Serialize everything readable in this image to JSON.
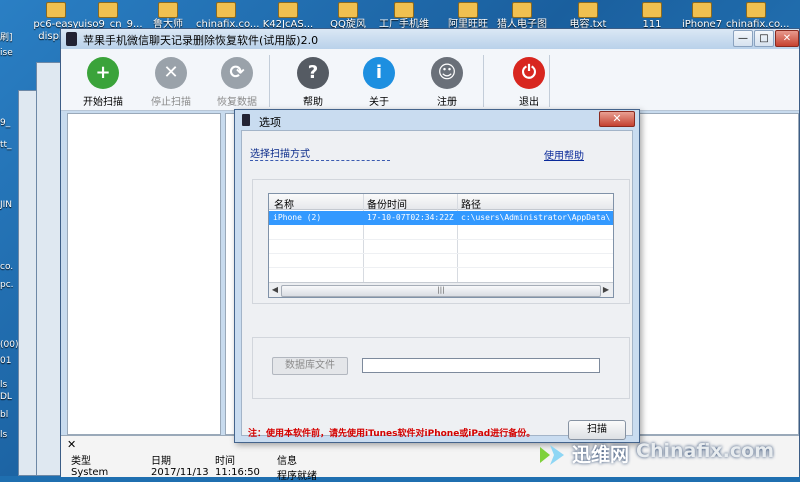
{
  "desktop": {
    "icons": [
      "pc6-easy display",
      "uiso9_cn_9...",
      "鲁大师",
      "chinafix.co...",
      "K42JcAS...",
      "QQ旋风",
      "工厂手机维",
      "阿里旺旺",
      "猎人电子图",
      "电容.txt",
      "111",
      "iPhone7",
      "chinafix.co..."
    ],
    "side_labels": [
      "刷]",
      "ise",
      "9_",
      "tt_",
      "JIN",
      "co.",
      "pc.",
      "(00)",
      "01",
      "ls",
      "DL",
      "bl",
      "ls"
    ]
  },
  "window": {
    "title": "苹果手机微信聊天记录删除恢复软件(试用版)2.0",
    "controls": {
      "minimize": "—",
      "maximize": "□",
      "close": "✕"
    }
  },
  "toolbar": [
    {
      "label": "开始扫描",
      "icon": "plus-icon",
      "color": "#3aa33a",
      "glyph": "+",
      "enabled": true
    },
    {
      "label": "停止扫描",
      "icon": "stop-icon",
      "color": "#9aa2aa",
      "glyph": "✕",
      "enabled": false
    },
    {
      "label": "恢复数据",
      "icon": "refresh-icon",
      "color": "#9aa2aa",
      "glyph": "⟳",
      "enabled": false
    },
    {
      "label": "帮助",
      "icon": "help-icon",
      "color": "#555b63",
      "glyph": "?",
      "enabled": true
    },
    {
      "label": "关于",
      "icon": "info-icon",
      "color": "#1d8fe0",
      "glyph": "i",
      "enabled": true
    },
    {
      "label": "注册",
      "icon": "user-icon",
      "color": "#6a7079",
      "glyph": "☺",
      "enabled": true
    },
    {
      "label": "退出",
      "icon": "power-icon",
      "color": "#d8261f",
      "glyph": "⏻",
      "enabled": true
    }
  ],
  "log": {
    "close": "✕",
    "columns": [
      "类型",
      "日期",
      "时间",
      "信息"
    ],
    "row": [
      "System",
      "2017/11/13",
      "11:16:50",
      "程序就绪"
    ]
  },
  "dialog": {
    "title": "选项",
    "close": "✕",
    "scan_method_label": "选择扫描方式",
    "help_link": "使用帮助",
    "table": {
      "columns": [
        "名称",
        "备份时间",
        "路径"
      ],
      "rows": [
        [
          "iPhone (2)",
          "17-10-07T02:34:22Z",
          "c:\\users\\Administrator\\AppData\\"
        ]
      ]
    },
    "db_file_button": "数据库文件",
    "db_file_value": "",
    "note": "注：使用本软件前，请先使用iTunes软件对iPhone或iPad进行备份。",
    "scan_button": "扫描"
  },
  "watermark": {
    "cn": "迅维网",
    "en": "Chinafix.com"
  }
}
